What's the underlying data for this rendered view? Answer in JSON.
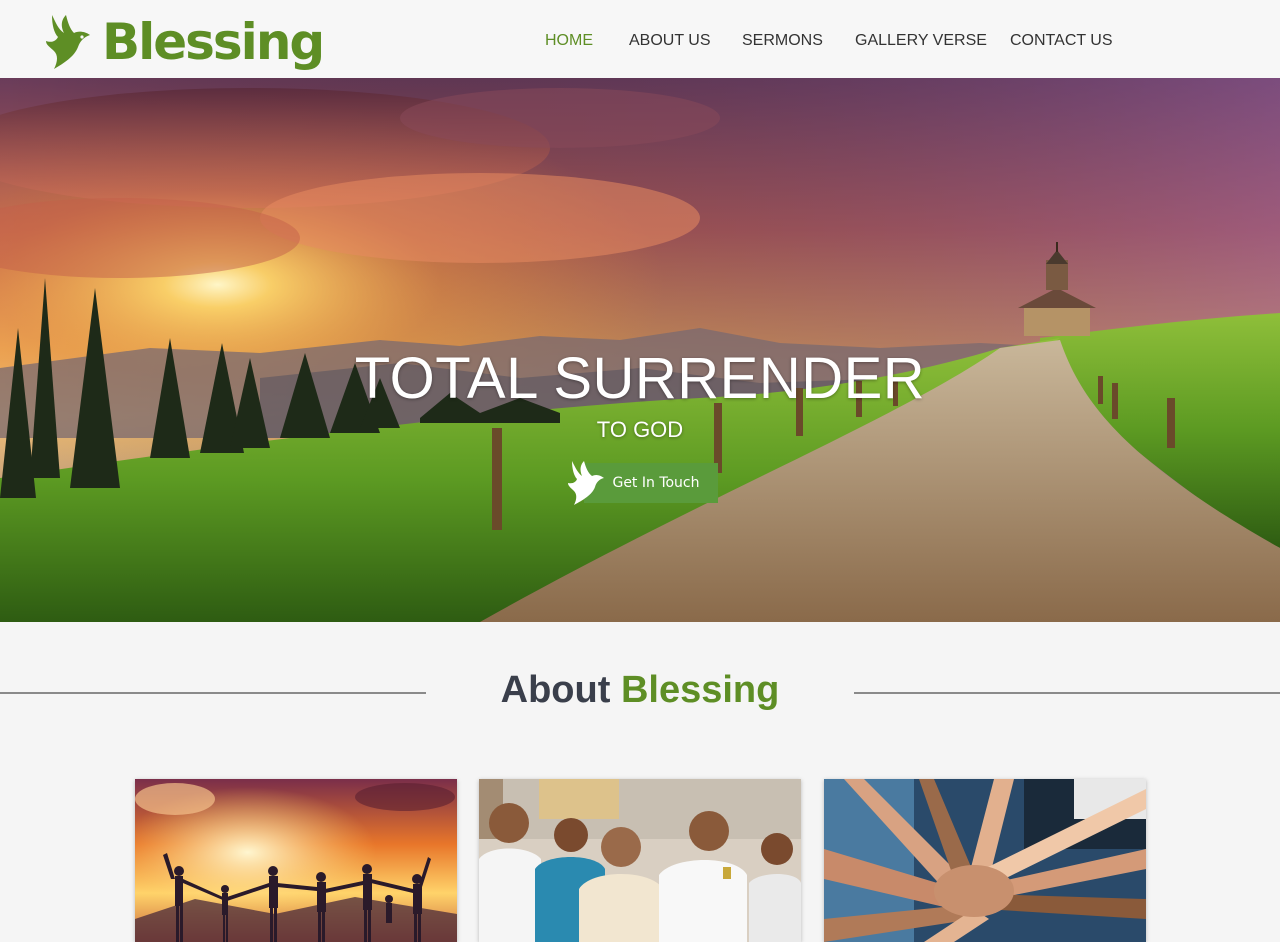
{
  "brand": {
    "name": "Blessing",
    "logo_icon": "dove-icon",
    "color": "#5e8e25"
  },
  "nav": {
    "items": [
      {
        "label": "HOME",
        "active": true
      },
      {
        "label": "ABOUT US",
        "active": false
      },
      {
        "label": "SERMONS",
        "active": false
      },
      {
        "label": "GALLERY VERSE",
        "active": false
      },
      {
        "label": "CONTACT US",
        "active": false
      }
    ]
  },
  "hero": {
    "title": "TOTAL SURRENDER",
    "subtitle": "TO GOD",
    "cta_label": "Get In Touch",
    "cta_icon": "dove-icon",
    "cta_color": "#5a9b3b"
  },
  "about": {
    "heading_part1": "About",
    "heading_part2": "Blessing",
    "cards": [
      {
        "image": "people-silhouettes-sunset-photo"
      },
      {
        "image": "congregation-praying-photo"
      },
      {
        "image": "stacked-hands-photo"
      }
    ]
  }
}
